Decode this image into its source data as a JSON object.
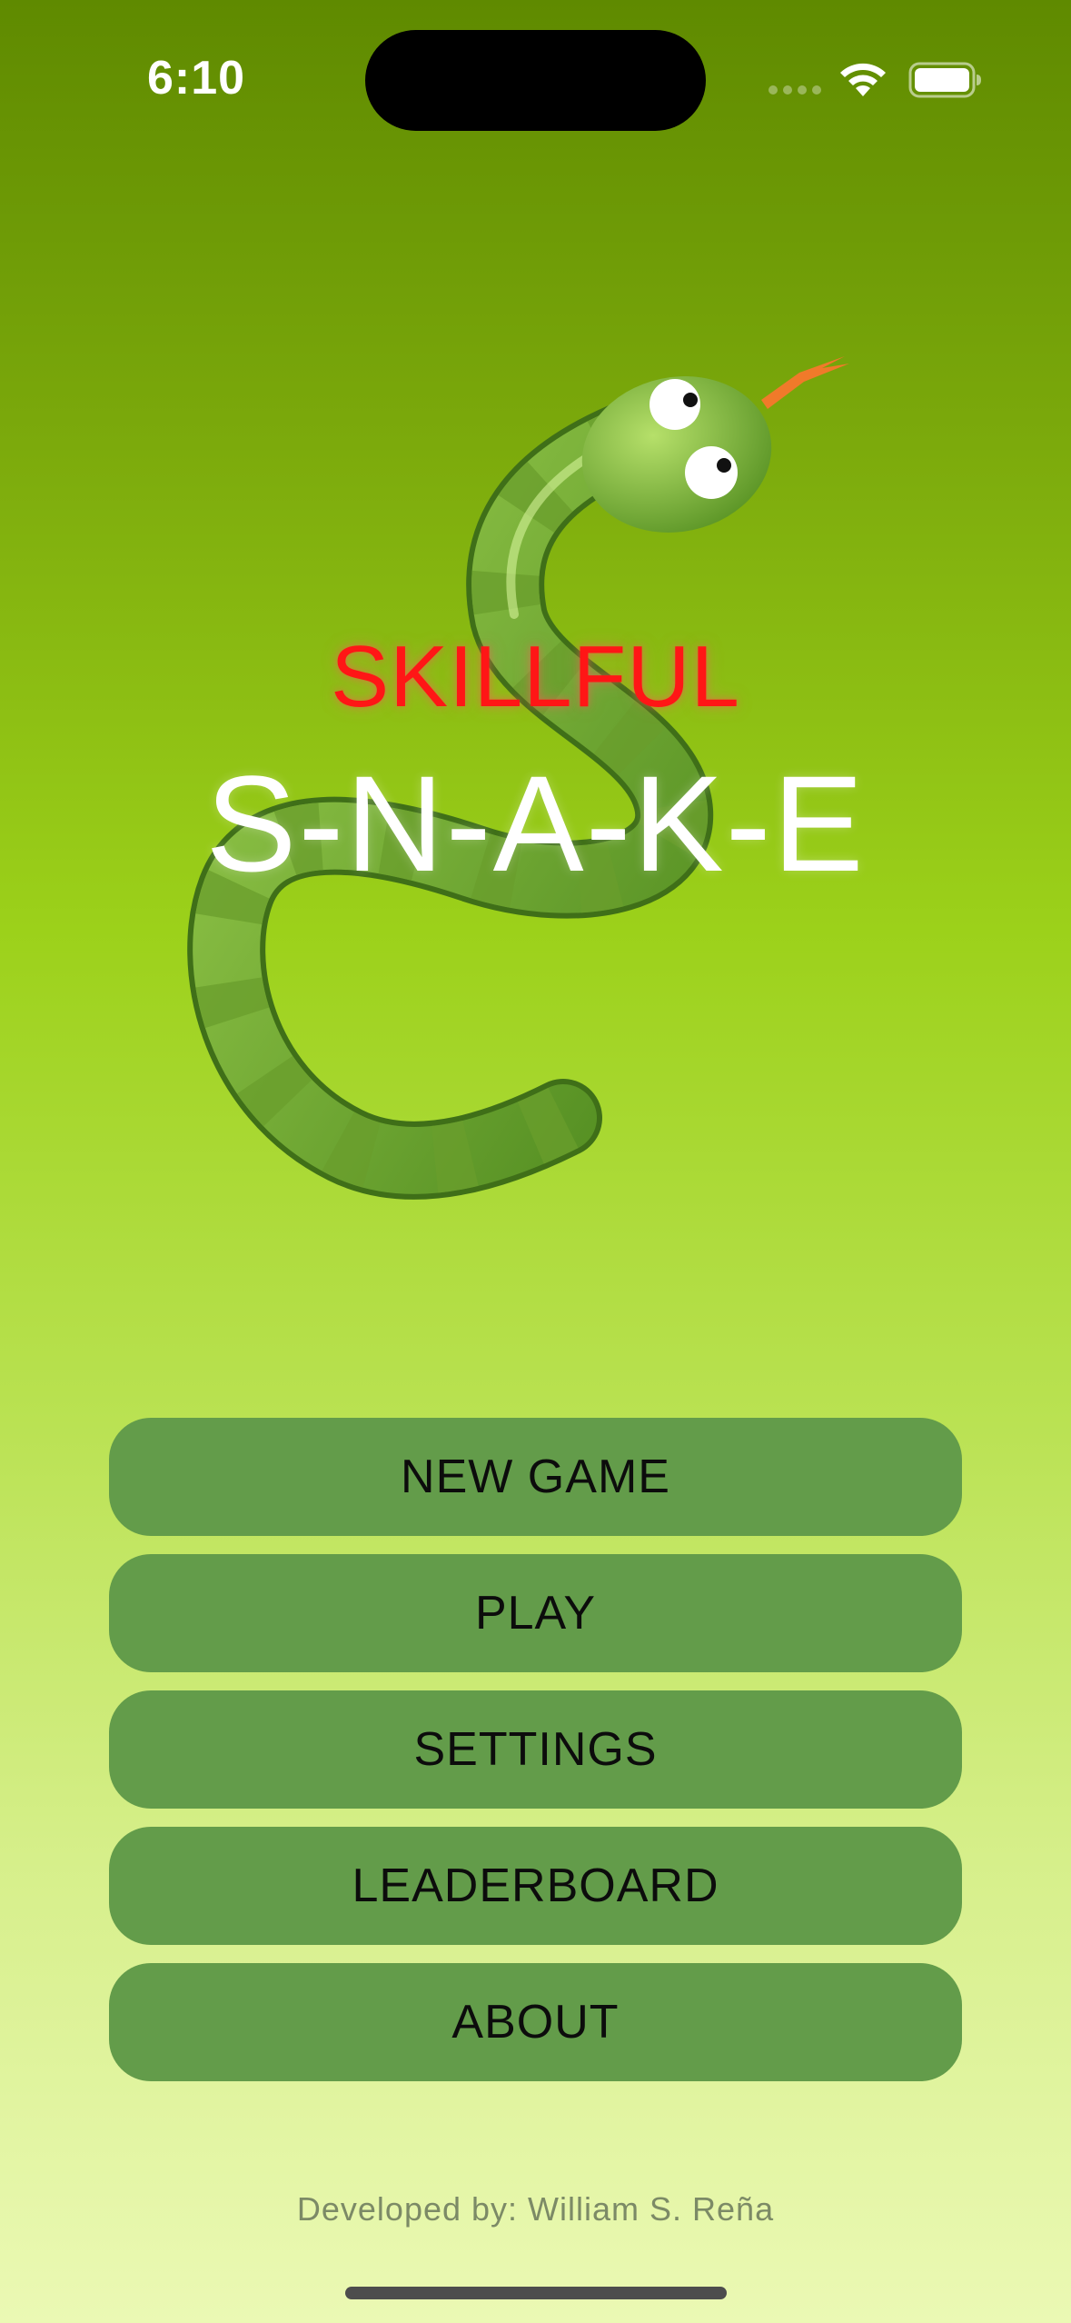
{
  "status_bar": {
    "time": "6:10",
    "icons": [
      "signal-dots-icon",
      "wifi-icon",
      "battery-icon"
    ]
  },
  "hero": {
    "image": "snake-illustration",
    "title_small": "SKILLFUL",
    "title_big": "S-N-A-K-E"
  },
  "menu": {
    "items": [
      {
        "label": "NEW GAME"
      },
      {
        "label": "PLAY"
      },
      {
        "label": "SETTINGS"
      },
      {
        "label": "LEADERBOARD"
      },
      {
        "label": "ABOUT"
      }
    ]
  },
  "footer": {
    "credit": "Developed by: William S. Reña"
  },
  "colors": {
    "title_small": "#ff1616",
    "title_big": "#ffffff",
    "button_bg": "#639c4a",
    "button_text": "#0c0c0c",
    "credit_text": "#7c8a66"
  }
}
